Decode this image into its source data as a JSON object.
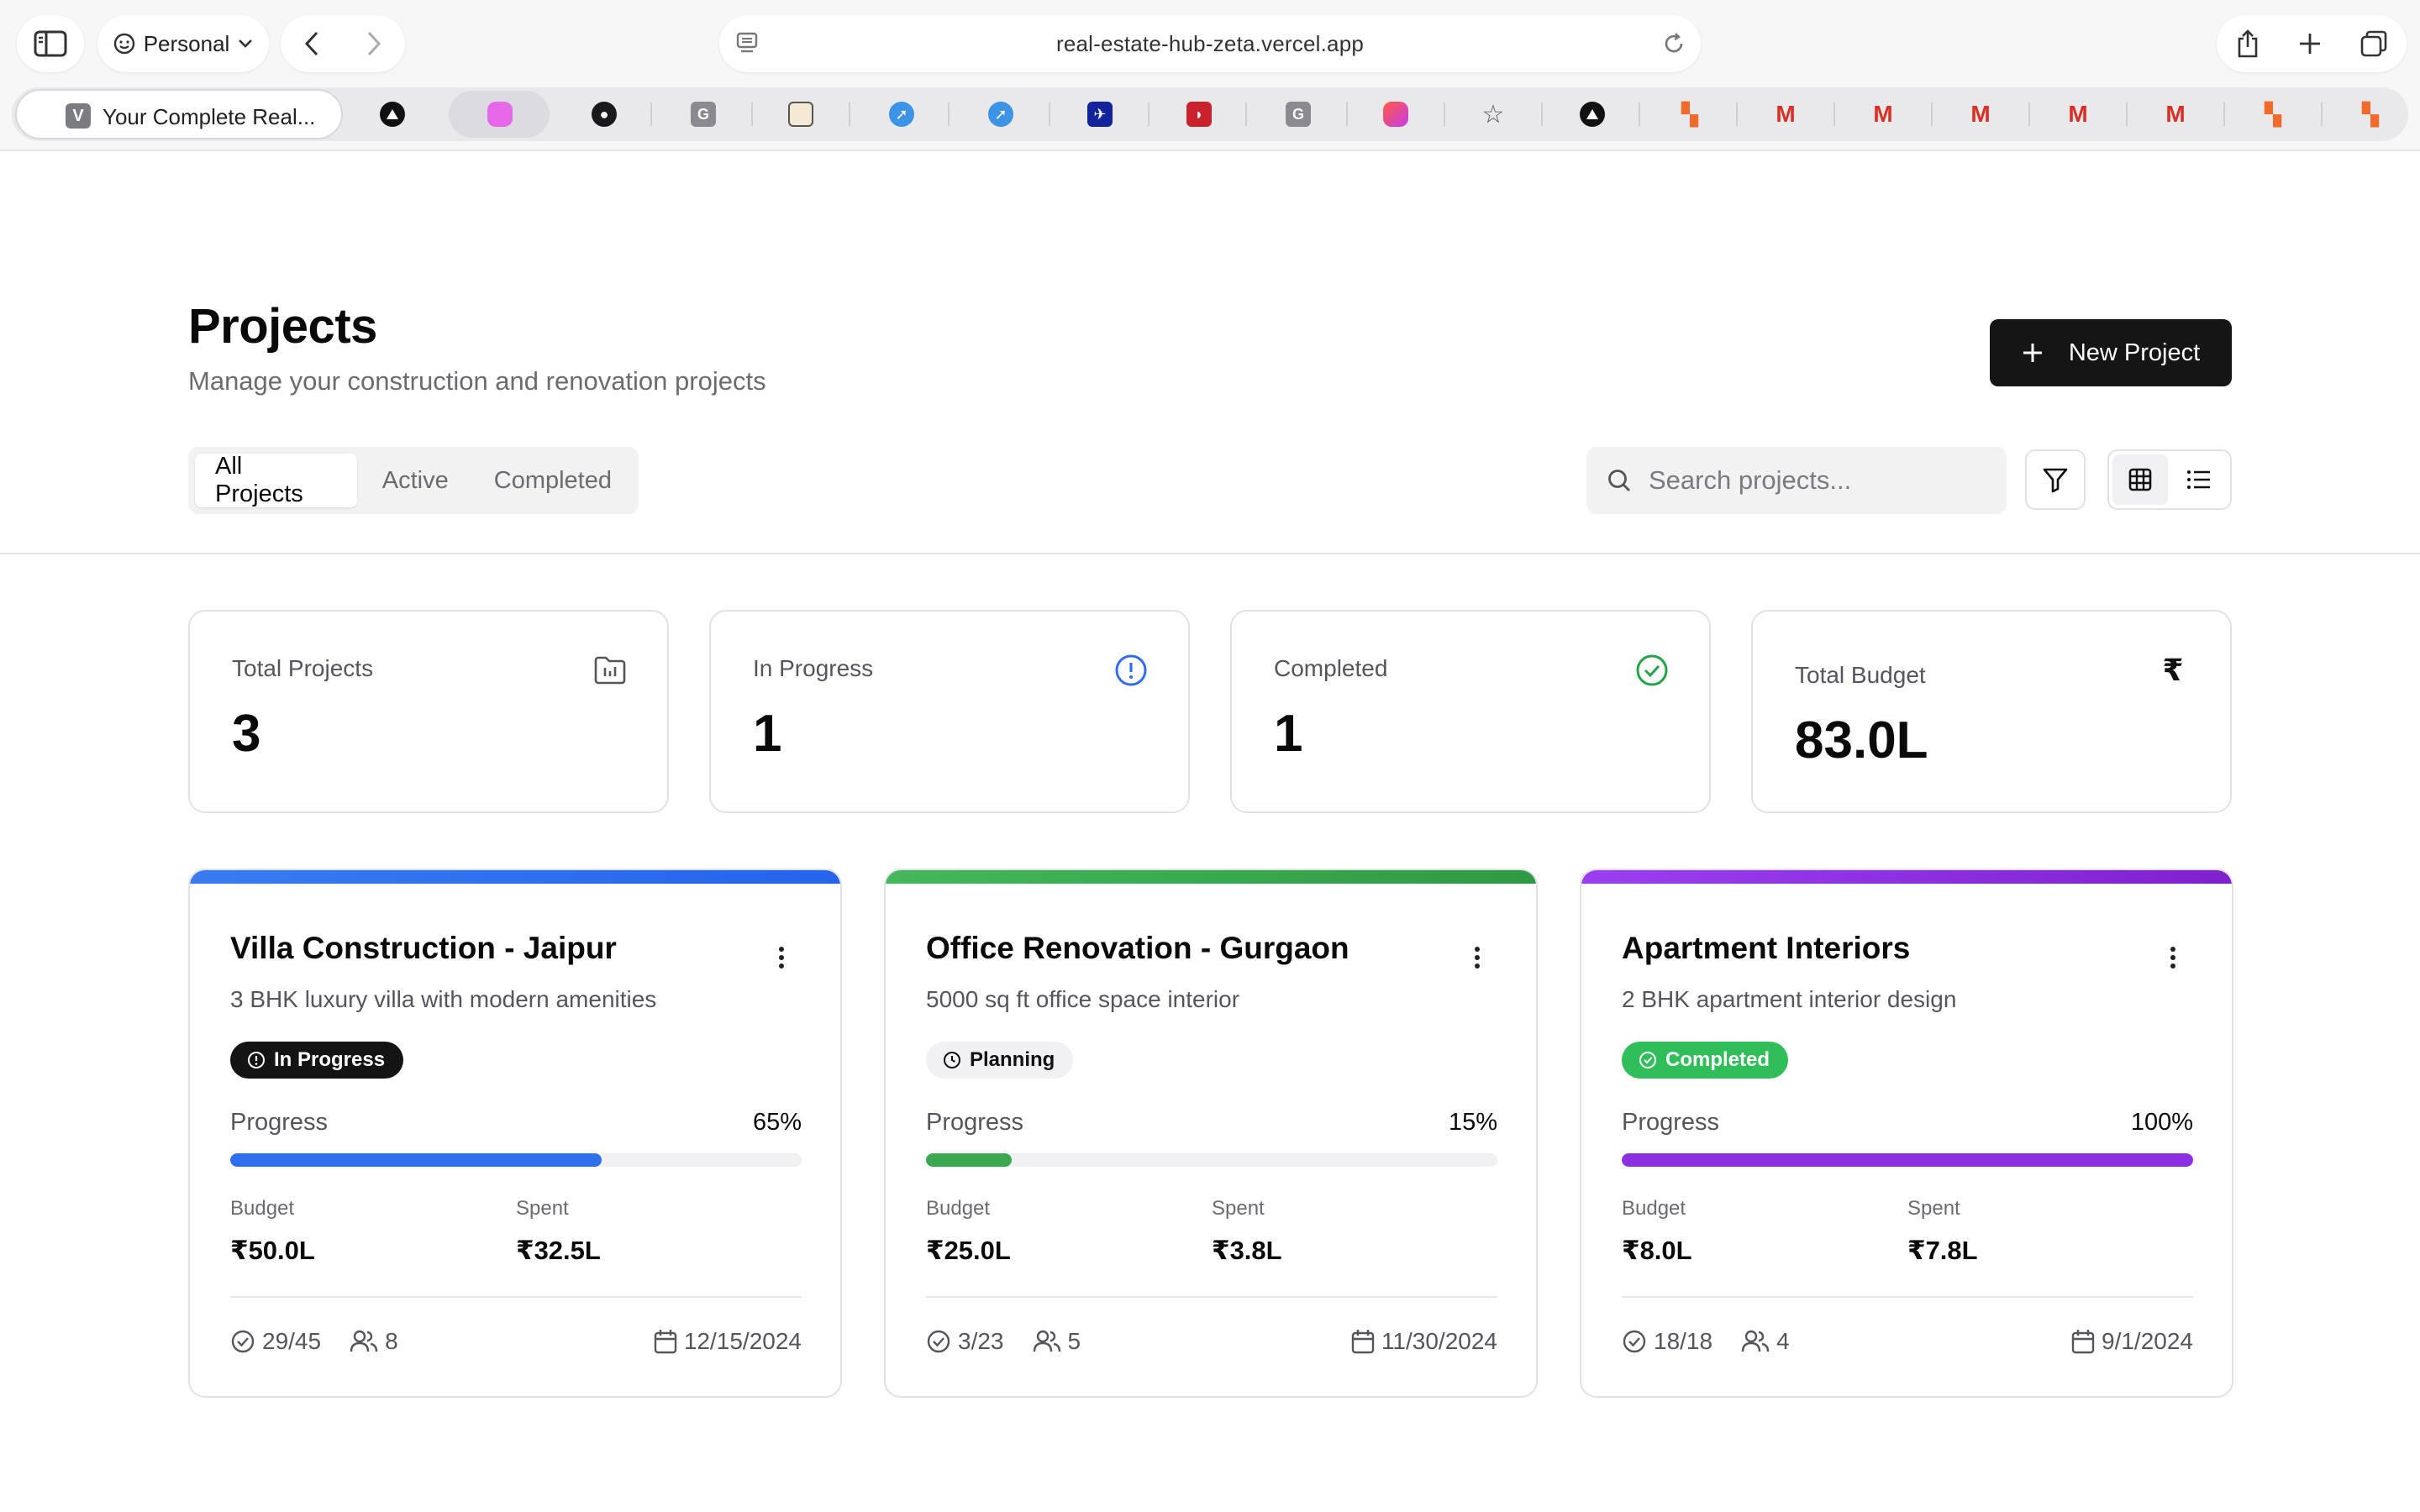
{
  "browser": {
    "profile_label": "Personal",
    "url": "real-estate-hub-zeta.vercel.app",
    "active_tab_title": "Your Complete Real...",
    "active_tab_favicon": "V"
  },
  "page": {
    "title": "Projects",
    "subtitle": "Manage your construction and renovation projects",
    "new_button_label": "New Project",
    "tabs": [
      "All Projects",
      "Active",
      "Completed"
    ],
    "search_placeholder": "Search projects..."
  },
  "stats": [
    {
      "label": "Total Projects",
      "value": "3",
      "icon": "folder-chart-icon"
    },
    {
      "label": "In Progress",
      "value": "1",
      "icon": "alert-circle-icon",
      "color": "#2f6fed"
    },
    {
      "label": "Completed",
      "value": "1",
      "icon": "check-circle-icon",
      "color": "#22a447"
    },
    {
      "label": "Total Budget",
      "value": "83.0L",
      "icon": "rupee-icon"
    }
  ],
  "projects": [
    {
      "title": "Villa Construction - Jaipur",
      "description": "3 BHK luxury villa with modern amenities",
      "status": "In Progress",
      "progress_label": "Progress",
      "progress": "65%",
      "progress_fraction": 0.65,
      "budget_label": "Budget",
      "budget": "₹50.0L",
      "spent_label": "Spent",
      "spent": "₹32.5L",
      "tasks": "29/45",
      "members": "8",
      "date": "12/15/2024",
      "accent": "#2f6fed"
    },
    {
      "title": "Office Renovation - Gurgaon",
      "description": "5000 sq ft office space interior",
      "status": "Planning",
      "progress_label": "Progress",
      "progress": "15%",
      "progress_fraction": 0.15,
      "budget_label": "Budget",
      "budget": "₹25.0L",
      "spent_label": "Spent",
      "spent": "₹3.8L",
      "tasks": "3/23",
      "members": "5",
      "date": "11/30/2024",
      "accent": "#3aa84f"
    },
    {
      "title": "Apartment Interiors",
      "description": "2 BHK apartment interior design",
      "status": "Completed",
      "progress_label": "Progress",
      "progress": "100%",
      "progress_fraction": 1.0,
      "budget_label": "Budget",
      "budget": "₹8.0L",
      "spent_label": "Spent",
      "spent": "₹7.8L",
      "tasks": "18/18",
      "members": "4",
      "date": "9/1/2024",
      "accent": "#8b2fe3"
    }
  ]
}
